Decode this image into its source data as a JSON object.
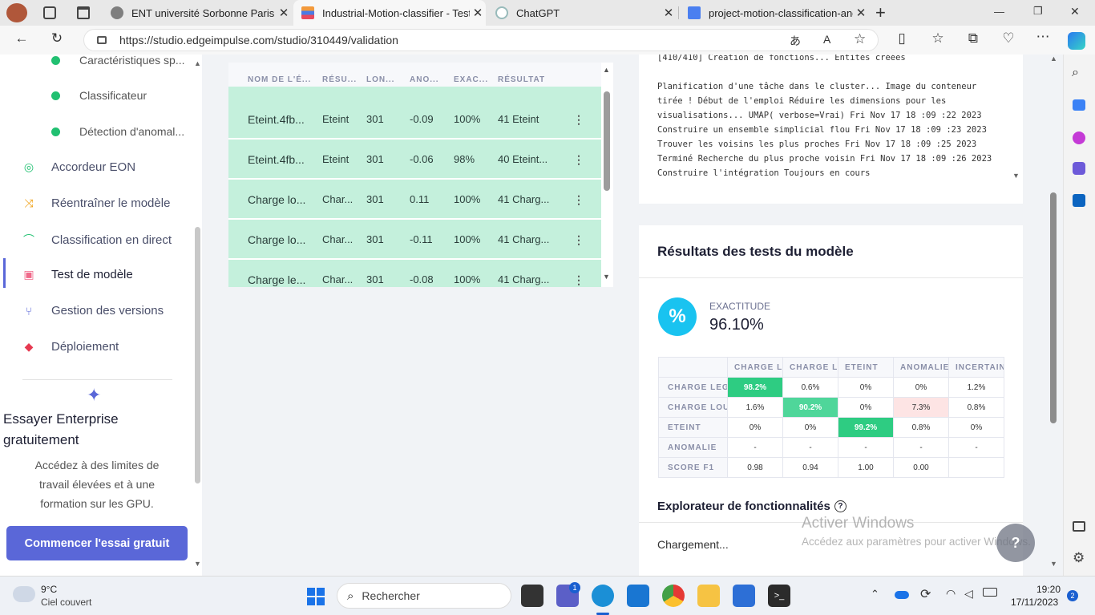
{
  "browser": {
    "tabs": [
      {
        "title": "ENT université Sorbonne Paris No",
        "icon": "ent-favicon"
      },
      {
        "title": "Industrial-Motion-classifier - Test",
        "icon": "edge-impulse-favicon"
      },
      {
        "title": "ChatGPT",
        "icon": "chatgpt-favicon"
      },
      {
        "title": "project-motion-classification-and",
        "icon": "google-docs-favicon"
      }
    ],
    "url": "https://studio.edgeimpulse.com/studio/310449/validation",
    "window_controls": [
      "—",
      "❐",
      "✕"
    ]
  },
  "sidebar": {
    "sub_items": [
      "Caractéristiques sp...",
      "Classificateur",
      "Détection d'anomal..."
    ],
    "items": [
      {
        "label": "Accordeur EON",
        "icon": "compass-icon"
      },
      {
        "label": "Réentraîner le modèle",
        "icon": "shuffle-icon"
      },
      {
        "label": "Classification en direct",
        "icon": "live-icon"
      },
      {
        "label": "Test de modèle",
        "icon": "clipboard-icon"
      },
      {
        "label": "Gestion des versions",
        "icon": "branch-icon"
      },
      {
        "label": "Déploiement",
        "icon": "box-icon"
      }
    ],
    "promo": {
      "title": "Essayer Enterprise gratuitement",
      "text": "Accédez à des limites de travail élevées et à une formation sur les GPU.",
      "button": "Commencer l'essai gratuit"
    }
  },
  "samples_table": {
    "headers": [
      "NOM DE L'É...",
      "RÉSU...",
      "LON...",
      "ANO...",
      "EXAC...",
      "RÉSULTAT"
    ],
    "rows": [
      [
        "Eteint.4fb...",
        "Eteint",
        "301",
        "-0.09",
        "100%",
        "41 Eteint"
      ],
      [
        "Eteint.4fb...",
        "Eteint",
        "301",
        "-0.06",
        "98%",
        "40 Eteint..."
      ],
      [
        "Charge lo...",
        "Char...",
        "301",
        "0.11",
        "100%",
        "41 Charg..."
      ],
      [
        "Charge lo...",
        "Char...",
        "301",
        "-0.11",
        "100%",
        "41 Charg..."
      ],
      [
        "Charge le...",
        "Char...",
        "301",
        "-0.08",
        "100%",
        "41 Charg..."
      ]
    ]
  },
  "log": {
    "text": "[410/410] Création de fonctions... Entités créées\n\nPlanification d'une tâche dans le cluster... Image du conteneur tirée ! Début de l'emploi Réduire les dimensions pour les visualisations... UMAP( verbose=Vrai) Fri Nov 17 18 :09 :22 2023 Construire un ensemble simplicial flou Fri Nov 17 18 :09 :23 2023 Trouver les voisins les plus proches Fri Nov 17 18 :09 :25 2023 Terminé Recherche du plus proche voisin Fri Nov 17 18 :09 :26 2023 Construire l'intégration Toujours en cours"
  },
  "results": {
    "title": "Résultats des tests du modèle",
    "accuracy_label": "EXACTITUDE",
    "accuracy_value": "96.10%",
    "matrix": {
      "columns": [
        "CHARGE LE",
        "CHARGE LC",
        "ETEINT",
        "ANOMALIE",
        "INCERTAIN"
      ],
      "rows": [
        {
          "label": "CHARGE LEG",
          "cells": [
            "98.2%",
            "0.6%",
            "0%",
            "0%",
            "1.2%"
          ],
          "highlight": [
            0
          ]
        },
        {
          "label": "CHARGE LOU",
          "cells": [
            "1.6%",
            "90.2%",
            "0%",
            "7.3%",
            "0.8%"
          ],
          "highlight": [
            1
          ],
          "warn": [
            3
          ]
        },
        {
          "label": "ETEINT",
          "cells": [
            "0%",
            "0%",
            "99.2%",
            "0.8%",
            "0%"
          ],
          "highlight": [
            2
          ]
        },
        {
          "label": "ANOMALIE",
          "cells": [
            "-",
            "-",
            "-",
            "-",
            "-"
          ]
        },
        {
          "label": "SCORE F1",
          "cells": [
            "0.98",
            "0.94",
            "1.00",
            "0.00",
            ""
          ]
        }
      ]
    },
    "explorer_title": "Explorateur de fonctionnalités",
    "loading": "Chargement..."
  },
  "watermark": {
    "title": "Activer Windows",
    "text": "Accédez aux paramètres pour activer Windows."
  },
  "taskbar": {
    "weather_temp": "9°C",
    "weather_desc": "Ciel couvert",
    "search_placeholder": "Rechercher",
    "teams_badge": "1",
    "time": "19:20",
    "date": "17/11/2023",
    "notification_count": "2"
  },
  "colors": {
    "accent": "#5a67d8",
    "row_green": "#c4f0dc",
    "cell_green": "#2ecc82",
    "cell_warn": "#fde4e4",
    "accuracy_circle": "#19c3f0"
  }
}
